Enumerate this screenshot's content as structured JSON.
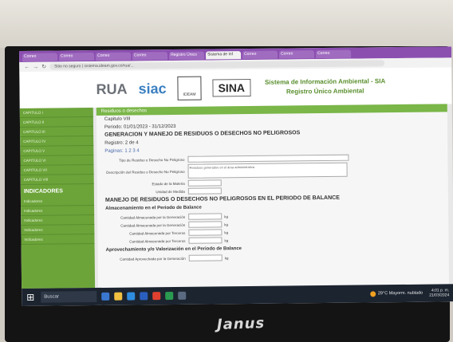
{
  "browser": {
    "tabs": [
      "Correo",
      "Correo",
      "Correo",
      "Correo",
      "Registro Único",
      "Sistema de Inf",
      "Correo",
      "Correo",
      "Correo"
    ],
    "active_tab": 5,
    "url": "Sitio no seguro  |  sistema.ideam.gov.co/rua/..."
  },
  "header": {
    "logo_rua": "RUA",
    "logo_siac": "siac",
    "logo_ideam": "IDEAM",
    "logo_sina": "SINA",
    "title_line1": "Sistema de Información Ambiental - SIA",
    "title_line2": "Registro Único Ambiental"
  },
  "sidebar": {
    "items": [
      "CAPITULO I",
      "CAPITULO II",
      "CAPITULO III",
      "CAPITULO IV",
      "CAPITULO V",
      "CAPITULO VI",
      "CAPITULO VII",
      "CAPITULO VIII"
    ],
    "indicators_heading": "INDICADORES",
    "indicator_items": [
      "Indicadores",
      "Indicadores",
      "Indicadores",
      "Indicadores",
      "Indicadores"
    ]
  },
  "main": {
    "section_bar": "Residuos o desechos",
    "chapter": "Capitulo VIII",
    "period": "Periodo: 01/01/2023 - 31/12/2023",
    "heading": "GENERACION Y MANEJO DE RESIDUOS O DESECHOS NO PELIGROSOS",
    "registros": "Registro: 2 de 4",
    "paginas": "Paginas: 1 2 3 4",
    "field1_label": "Tipo de Residuo o Desecho No Peligroso",
    "field2_label": "Descripción del Residuo o Desecho No Peligroso",
    "textarea_value": "Residuos generados en el área administrativa",
    "field3_label": "Estado de la Materia",
    "field4_label": "Unidad de Medida",
    "section2": "MANEJO DE RESIDUOS O DESECHOS NO PELIGROSOS EN EL PERIODO DE BALANCE",
    "subsection1": "Almacenamiento en el Periodo de Balance",
    "row1": "Cantidad Almacenada por la Generación",
    "row2": "Cantidad Almacenada por la Generación",
    "row3": "Cantidad Almacenada por Terceros",
    "row4": "Cantidad Almacenada por Terceros",
    "unit": "kg",
    "subsection2": "Aprovechamiento y/o Valorización en el Periodo de Balance",
    "row5": "Cantidad Aprovechada por la Generación"
  },
  "taskbar": {
    "search_placeholder": "Buscar",
    "weather": "29°C  Mayorm. nublado",
    "time": "4:01 p. m.",
    "date": "21/03/2024"
  },
  "monitor": {
    "brand": "Janus"
  },
  "colors": {
    "accent_green": "#7ab648",
    "sidebar_green": "#6ca43a",
    "tabbar_purple": "#8b4fb0"
  }
}
